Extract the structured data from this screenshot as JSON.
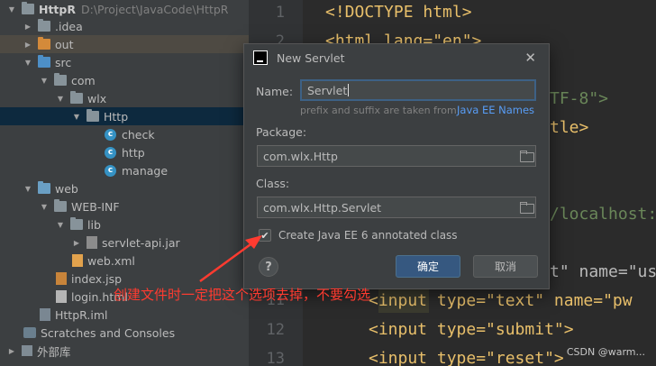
{
  "tree": {
    "items": [
      {
        "label": "HttpR",
        "suffix": "D:\\Project\\JavaCode\\HttpR",
        "icon": "folder-icon",
        "arrow": "▼"
      },
      {
        "label": ".idea",
        "icon": "folder-icon",
        "arrow": "▶"
      },
      {
        "label": "out",
        "icon": "folder-icon",
        "arrow": "▶"
      },
      {
        "label": "src",
        "icon": "folder-icon",
        "arrow": "▼"
      },
      {
        "label": "com",
        "icon": "folder-icon",
        "arrow": "▼"
      },
      {
        "label": "wlx",
        "icon": "folder-icon",
        "arrow": "▼"
      },
      {
        "label": "Http",
        "icon": "folder-icon",
        "arrow": "▼"
      },
      {
        "label": "check",
        "icon": "class-icon"
      },
      {
        "label": "http",
        "icon": "class-icon"
      },
      {
        "label": "manage",
        "icon": "class-icon"
      },
      {
        "label": "web",
        "icon": "folder-icon",
        "arrow": "▼"
      },
      {
        "label": "WEB-INF",
        "icon": "folder-icon",
        "arrow": "▼"
      },
      {
        "label": "lib",
        "icon": "folder-icon",
        "arrow": "▼"
      },
      {
        "label": "servlet-api.jar",
        "icon": "jar-icon",
        "arrow": "▶"
      },
      {
        "label": "web.xml",
        "icon": "xml-icon"
      },
      {
        "label": "index.jsp",
        "icon": "jsp-icon"
      },
      {
        "label": "login.html",
        "icon": "html-icon"
      },
      {
        "label": "HttpR.iml",
        "icon": "iml-icon"
      },
      {
        "label": "Scratches and Consoles",
        "icon": "scratch-icon"
      },
      {
        "label": "外部库",
        "icon": "library-icon",
        "arrow": "▶"
      }
    ]
  },
  "editor": {
    "line_numbers": [
      "1",
      "2",
      "11",
      "12",
      "13"
    ],
    "lines": [
      {
        "a": "<!DOCTYPE html>"
      },
      {
        "a": "<html lang=\"en\">"
      },
      {
        "a": "TF-8\">"
      },
      {
        "a": "tle>"
      },
      {
        "a": "/localhost:"
      },
      {
        "a": "t\" name=\"us"
      },
      {
        "a": "<input type=\"text\" name=\"pw"
      },
      {
        "a": "<input type=\"submit\">"
      },
      {
        "a": "<input type=\"reset\">"
      }
    ]
  },
  "dialog": {
    "title": "New Servlet",
    "close": "✕",
    "name_label": "Name:",
    "name_value": "Servlet",
    "hint": "prefix and suffix are taken from",
    "hint_link": "Java EE Names",
    "package_label": "Package:",
    "package_value": "com.wlx.Http",
    "class_label": "Class:",
    "class_value": "com.wlx.Http.Servlet",
    "checkbox_label": "Create Java EE 6 annotated class",
    "checkbox_checked": "✔",
    "help": "?",
    "ok_label": "确定",
    "cancel_label": "取消"
  },
  "annotation": {
    "text": "创建文件时一定把这个选项去掉，不要勾选",
    "color": "#ff3b30"
  },
  "watermark": "CSDN @warm..."
}
